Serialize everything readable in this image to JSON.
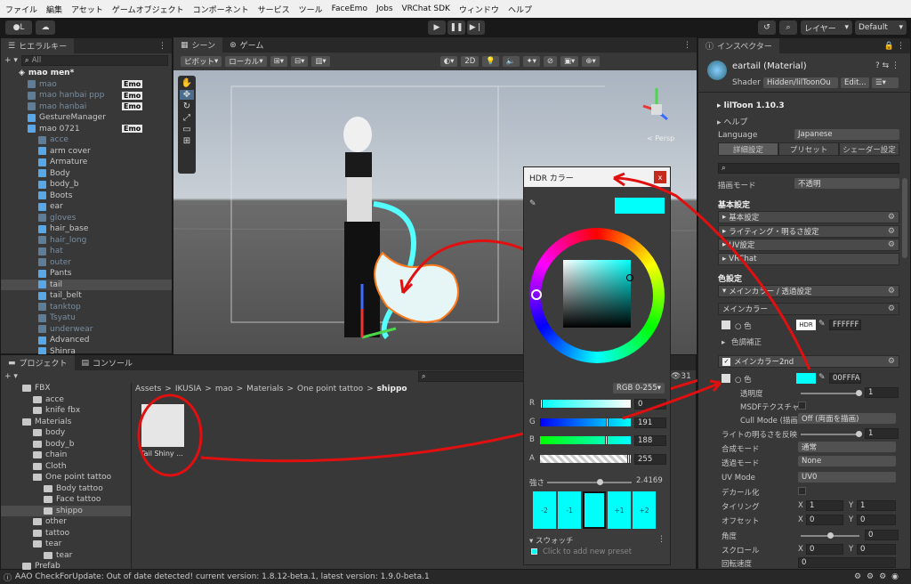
{
  "menu": [
    "ファイル",
    "編集",
    "アセット",
    "ゲームオブジェクト",
    "コンポーネント",
    "サービス",
    "ツール",
    "FaceEmo",
    "Jobs",
    "VRChat SDK",
    "ウィンドウ",
    "ヘルプ"
  ],
  "toolbar": {
    "account": "L",
    "layers": "レイヤー",
    "layout": "Default"
  },
  "hierarchy": {
    "tab": "ヒエラルキー",
    "search_placeholder": "All",
    "scene": "mao men*",
    "items": [
      {
        "label": "mao",
        "dim": true,
        "emo": "Emo"
      },
      {
        "label": "mao hanbai ppp",
        "dim": true,
        "emo": "Emo"
      },
      {
        "label": "mao hanbai",
        "dim": true,
        "emo": "Emo"
      },
      {
        "label": "GestureManager",
        "dim": false,
        "emo": ""
      },
      {
        "label": "mao 0721",
        "dim": false,
        "emo": "Emo"
      },
      {
        "label": "acce",
        "dim": true,
        "emo": ""
      },
      {
        "label": "arm cover",
        "dim": false,
        "emo": ""
      },
      {
        "label": "Armature",
        "dim": false,
        "emo": ""
      },
      {
        "label": "Body",
        "dim": false,
        "emo": ""
      },
      {
        "label": "body_b",
        "dim": false,
        "emo": ""
      },
      {
        "label": "Boots",
        "dim": false,
        "emo": ""
      },
      {
        "label": "ear",
        "dim": false,
        "emo": ""
      },
      {
        "label": "gloves",
        "dim": true,
        "emo": ""
      },
      {
        "label": "hair_base",
        "dim": false,
        "emo": ""
      },
      {
        "label": "hair_long",
        "dim": true,
        "emo": ""
      },
      {
        "label": "hat",
        "dim": true,
        "emo": ""
      },
      {
        "label": "outer",
        "dim": true,
        "emo": ""
      },
      {
        "label": "Pants",
        "dim": false,
        "emo": ""
      },
      {
        "label": "tail",
        "dim": false,
        "emo": ""
      },
      {
        "label": "tail_belt",
        "dim": false,
        "emo": ""
      },
      {
        "label": "tanktop",
        "dim": true,
        "emo": ""
      },
      {
        "label": "Tsyatu",
        "dim": true,
        "emo": ""
      },
      {
        "label": "underwear",
        "dim": true,
        "emo": ""
      },
      {
        "label": "Advanced",
        "dim": false,
        "emo": ""
      },
      {
        "label": "Shinra",
        "dim": false,
        "emo": ""
      }
    ]
  },
  "scene": {
    "tab_scene": "シーン",
    "tab_game": "ゲーム",
    "pivot": "ピボット",
    "local": "ローカル",
    "mode2d": "2D",
    "persp": "< Persp"
  },
  "project": {
    "tab_project": "プロジェクト",
    "tab_console": "コンソール",
    "breadcrumb": [
      "Assets",
      "IKUSIA",
      "mao",
      "Materials",
      "One point tattoo",
      "shippo"
    ],
    "count": "31",
    "tree": [
      {
        "label": "FBX",
        "indent": 2
      },
      {
        "label": "acce",
        "indent": 3
      },
      {
        "label": "knife fbx",
        "indent": 3
      },
      {
        "label": "Materials",
        "indent": 2
      },
      {
        "label": "body",
        "indent": 3
      },
      {
        "label": "body_b",
        "indent": 3
      },
      {
        "label": "chain",
        "indent": 3
      },
      {
        "label": "Cloth",
        "indent": 3
      },
      {
        "label": "One point tattoo",
        "indent": 3
      },
      {
        "label": "Body tattoo",
        "indent": 4
      },
      {
        "label": "Face tattoo",
        "indent": 4
      },
      {
        "label": "shippo",
        "indent": 4
      },
      {
        "label": "other",
        "indent": 3
      },
      {
        "label": "tattoo",
        "indent": 3
      },
      {
        "label": "tear",
        "indent": 3
      },
      {
        "label": "tear",
        "indent": 4
      },
      {
        "label": "Prefab",
        "indent": 2
      },
      {
        "label": "Shinra_VetGirl",
        "indent": 1
      }
    ],
    "asset_label": "Tail Shiny ..."
  },
  "status": {
    "message": "AAO CheckForUpdate: Out of date detected! current version: 1.8.12-beta.1, latest version: 1.9.0-beta.1"
  },
  "hdr": {
    "title": "HDR カラー",
    "mode": "RGB 0-255",
    "channels": [
      {
        "name": "R",
        "value": "0"
      },
      {
        "name": "G",
        "value": "191"
      },
      {
        "name": "B",
        "value": "188"
      },
      {
        "name": "A",
        "value": "255"
      }
    ],
    "channel_levels": [
      0.0,
      0.75,
      0.74,
      1.0
    ],
    "intensity_label": "強さ",
    "intensity": "2.4169",
    "swatches": [
      "-2",
      "-1",
      "",
      "+1",
      "+2"
    ],
    "swatch_label": "スウォッチ",
    "preset_hint": "Click to add new preset",
    "color": "#00FFFA"
  },
  "inspector": {
    "tab": "インスペクター",
    "name": "eartail (Material)",
    "shader_label": "Shader",
    "shader": "Hidden/lilToonOu",
    "edit": "Edit...",
    "liltoon": "lilToon 1.10.3",
    "help": "ヘルプ",
    "language_label": "Language",
    "language": "Japanese",
    "mode_tabs": [
      "詳細設定",
      "プリセット",
      "シェーダー設定"
    ],
    "render_label": "描画モード",
    "render": "不透明",
    "basic_header": "基本設定",
    "basic_items": [
      "基本設定",
      "ライティング・明るさ設定",
      "UV設定",
      "VRChat"
    ],
    "color_header": "色設定",
    "main_color_group": "メインカラー / 透過設定",
    "main_color": "メインカラー",
    "color_label": "色",
    "color1_hex": "FFFFFF",
    "hdr_tag": "HDR",
    "color_adjust": "色調補正",
    "main2nd": "メインカラー2nd",
    "color2_hex": "00FFFA",
    "opacity_label": "透明度",
    "opacity": "1",
    "msdf": "MSDFテクスチャ",
    "cull_label": "Cull Mode (描画",
    "cull": "Off (両面を描画)",
    "light_invert": "ライトの明るさを反映",
    "light_invert_value": "1",
    "blend_label": "合成モード",
    "blend": "通常",
    "transparent_label": "透過モード",
    "transparent": "None",
    "uv_label": "UV Mode",
    "uv": "UV0",
    "decal": "デカール化",
    "tiling": "タイリング",
    "offset": "オフセット",
    "tiling_x": "1",
    "tiling_y": "1",
    "offset_x": "0",
    "offset_y": "0",
    "angle": "角度",
    "angle_value": "0",
    "scroll": "スクロール",
    "scroll_x": "0",
    "scroll_y": "0",
    "rot_speed": "回転速度",
    "rot_value": "0"
  },
  "colors": {
    "accent": "#00FFFA",
    "selection": "#2c5d87"
  }
}
